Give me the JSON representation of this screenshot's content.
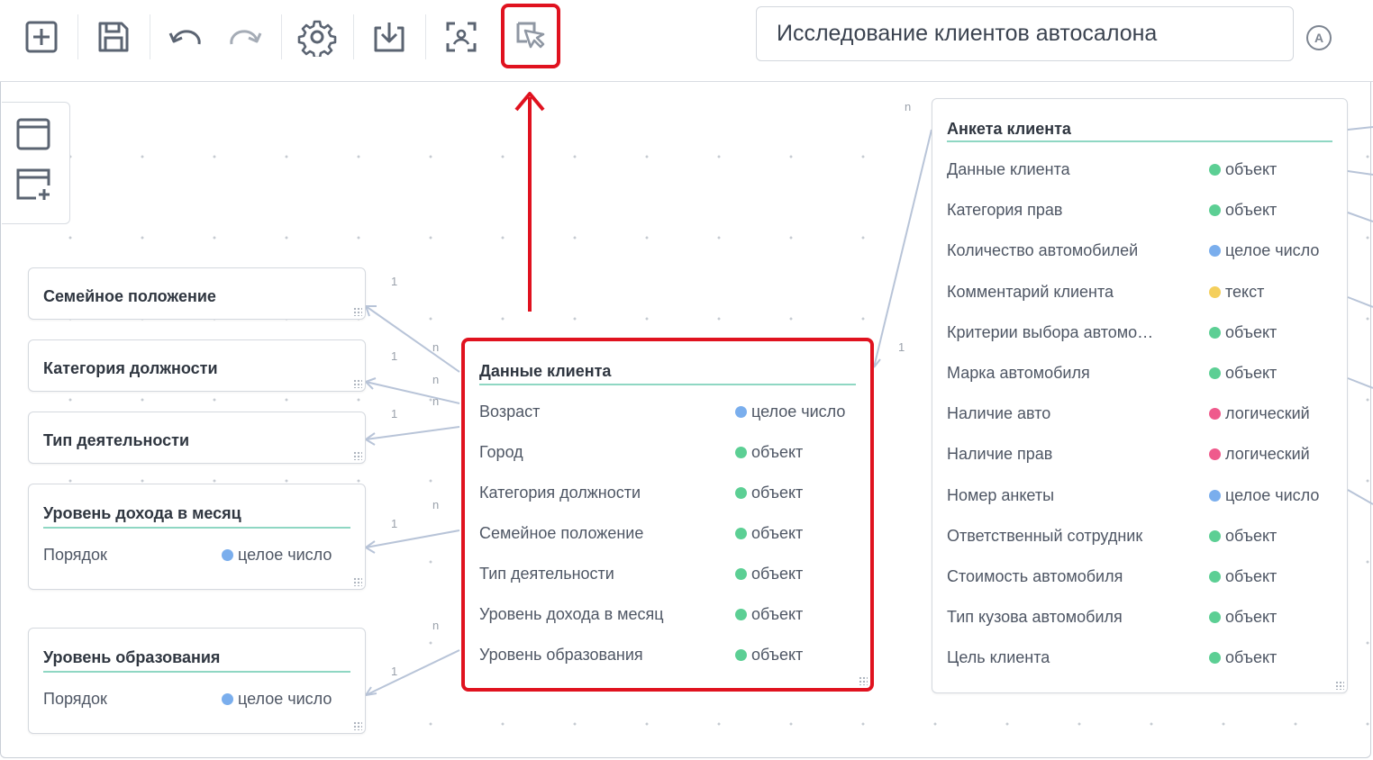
{
  "toolbar": {
    "buttons": [
      {
        "name": "add-button",
        "icon": "plus-square-icon"
      },
      {
        "name": "save-button",
        "icon": "floppy-disk-icon"
      },
      {
        "name": "undo-button",
        "icon": "undo-arrow-icon"
      },
      {
        "name": "redo-button",
        "icon": "redo-arrow-icon"
      },
      {
        "name": "settings-button",
        "icon": "gear-icon"
      },
      {
        "name": "download-button",
        "icon": "download-icon"
      },
      {
        "name": "focus-button",
        "icon": "scan-focus-icon"
      },
      {
        "name": "edit-selection-button",
        "icon": "cursor-edit-icon",
        "highlighted": true
      }
    ],
    "title_value": "Исследование клиентов автосалона",
    "avatar_letter": "A"
  },
  "colors": {
    "highlight": "#e0121f",
    "accent_line": "#8fd7c3",
    "type_object": "#5ccf94",
    "type_integer": "#7aaeed",
    "type_text": "#f4cf5c",
    "type_boolean": "#ef5a8c"
  },
  "sidebar": {
    "buttons": [
      {
        "icon": "window-icon"
      },
      {
        "icon": "add-window-icon"
      }
    ]
  },
  "link_labels": {
    "one": "1",
    "many": "n"
  },
  "cards": {
    "marital": {
      "title": "Семейное положение"
    },
    "position": {
      "title": "Категория должности"
    },
    "activity": {
      "title": "Тип деятельности"
    },
    "income": {
      "title": "Уровень дохода в месяц",
      "fields": [
        {
          "name": "Порядок",
          "type": "целое число",
          "color": "type_integer"
        }
      ]
    },
    "education": {
      "title": "Уровень образования",
      "fields": [
        {
          "name": "Порядок",
          "type": "целое число",
          "color": "type_integer"
        }
      ]
    },
    "client_data": {
      "title": "Данные клиента",
      "fields": [
        {
          "name": "Возраст",
          "type": "целое число",
          "color": "type_integer"
        },
        {
          "name": "Город",
          "type": "объект",
          "color": "type_object"
        },
        {
          "name": "Категория должности",
          "type": "объект",
          "color": "type_object"
        },
        {
          "name": "Семейное положение",
          "type": "объект",
          "color": "type_object"
        },
        {
          "name": "Тип деятельности",
          "type": "объект",
          "color": "type_object"
        },
        {
          "name": "Уровень дохода в месяц",
          "type": "объект",
          "color": "type_object"
        },
        {
          "name": "Уровень образования",
          "type": "объект",
          "color": "type_object"
        }
      ]
    },
    "questionnaire": {
      "title": "Анкета клиента",
      "fields": [
        {
          "name": "Данные клиента",
          "type": "объект",
          "color": "type_object"
        },
        {
          "name": "Категория прав",
          "type": "объект",
          "color": "type_object"
        },
        {
          "name": "Количество автомобилей",
          "type": "целое число",
          "color": "type_integer"
        },
        {
          "name": "Комментарий клиента",
          "type": "текст",
          "color": "type_text"
        },
        {
          "name": "Критерии выбора автомо…",
          "type": "объект",
          "color": "type_object"
        },
        {
          "name": "Марка автомобиля",
          "type": "объект",
          "color": "type_object"
        },
        {
          "name": "Наличие авто",
          "type": "логический",
          "color": "type_boolean"
        },
        {
          "name": "Наличие прав",
          "type": "логический",
          "color": "type_boolean"
        },
        {
          "name": "Номер анкеты",
          "type": "целое число",
          "color": "type_integer"
        },
        {
          "name": "Ответственный сотрудник",
          "type": "объект",
          "color": "type_object"
        },
        {
          "name": "Стоимость автомобиля",
          "type": "объект",
          "color": "type_object"
        },
        {
          "name": "Тип кузова автомобиля",
          "type": "объект",
          "color": "type_object"
        },
        {
          "name": "Цель клиента",
          "type": "объект",
          "color": "type_object"
        }
      ]
    }
  }
}
